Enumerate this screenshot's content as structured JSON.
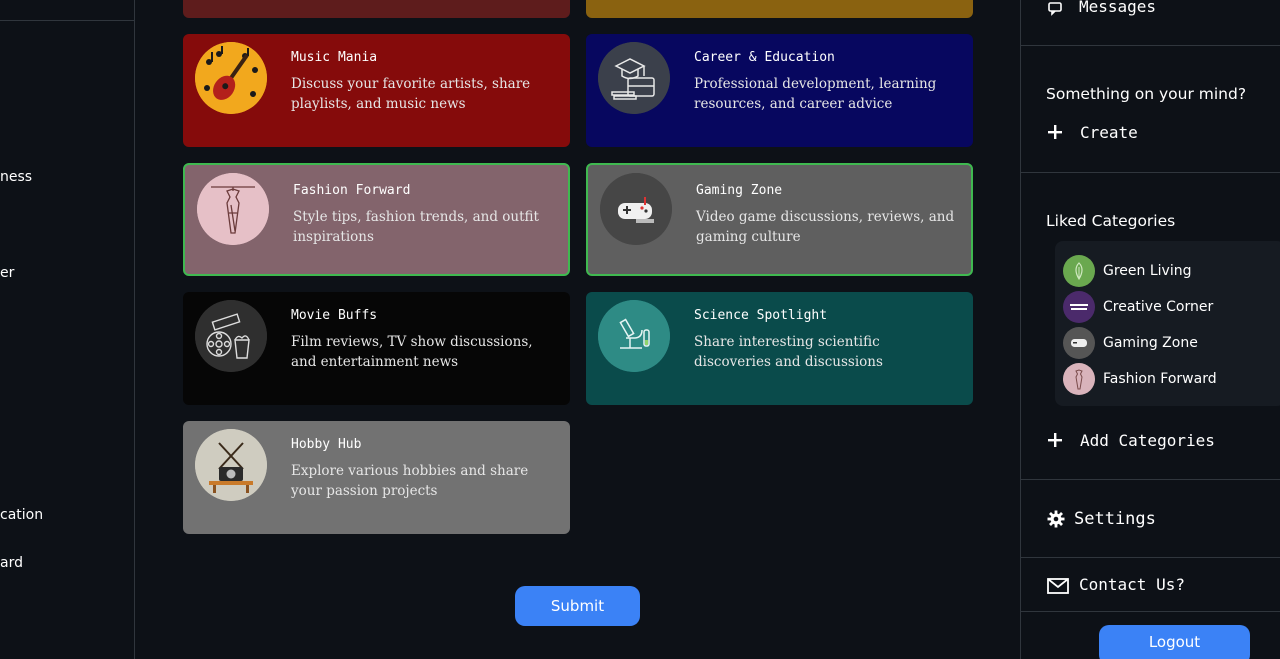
{
  "left_sidebar": {
    "items": [
      "ness",
      "er",
      "cation",
      "ard"
    ]
  },
  "cards": [
    {
      "title": "Music Mania",
      "desc": "Discuss your favorite artists, share playlists, and music news",
      "icon": "guitar-icon",
      "bg": "#850b0b"
    },
    {
      "title": "Career & Education",
      "desc": "Professional development, learning resources, and career advice",
      "icon": "graduation-cap-icon",
      "bg": "#07075f"
    },
    {
      "title": "Fashion Forward",
      "desc": "Style tips, fashion trends, and outfit inspirations",
      "icon": "dress-icon",
      "bg": "#83646c"
    },
    {
      "title": "Gaming Zone",
      "desc": "Video game discussions, reviews, and gaming culture",
      "icon": "gamepad-icon",
      "bg": "#5f5f5f"
    },
    {
      "title": "Movie Buffs",
      "desc": "Film reviews, TV show discussions, and entertainment news",
      "icon": "film-reel-icon",
      "bg": "#060606"
    },
    {
      "title": "Science Spotlight",
      "desc": "Share interesting scientific discoveries and discussions",
      "icon": "microscope-icon",
      "bg": "#0a4b4b"
    },
    {
      "title": "Hobby Hub",
      "desc": "Explore various hobbies and share your passion projects",
      "icon": "camera-icon",
      "bg": "#727272"
    }
  ],
  "submit_label": "Submit",
  "right_sidebar": {
    "messages_label": "Messages",
    "prompt": "Something on your mind?",
    "create_label": "Create",
    "liked_heading": "Liked Categories",
    "liked": [
      {
        "name": "Green Living",
        "color": "#6aa84f"
      },
      {
        "name": "Creative Corner",
        "color": "#4b2a6b"
      },
      {
        "name": "Gaming Zone",
        "color": "#555555"
      },
      {
        "name": "Fashion Forward",
        "color": "#d9b3bb"
      }
    ],
    "add_categories_label": "Add Categories",
    "settings_label": "Settings",
    "contact_label": "Contact Us?",
    "logout_label": "Logout"
  }
}
